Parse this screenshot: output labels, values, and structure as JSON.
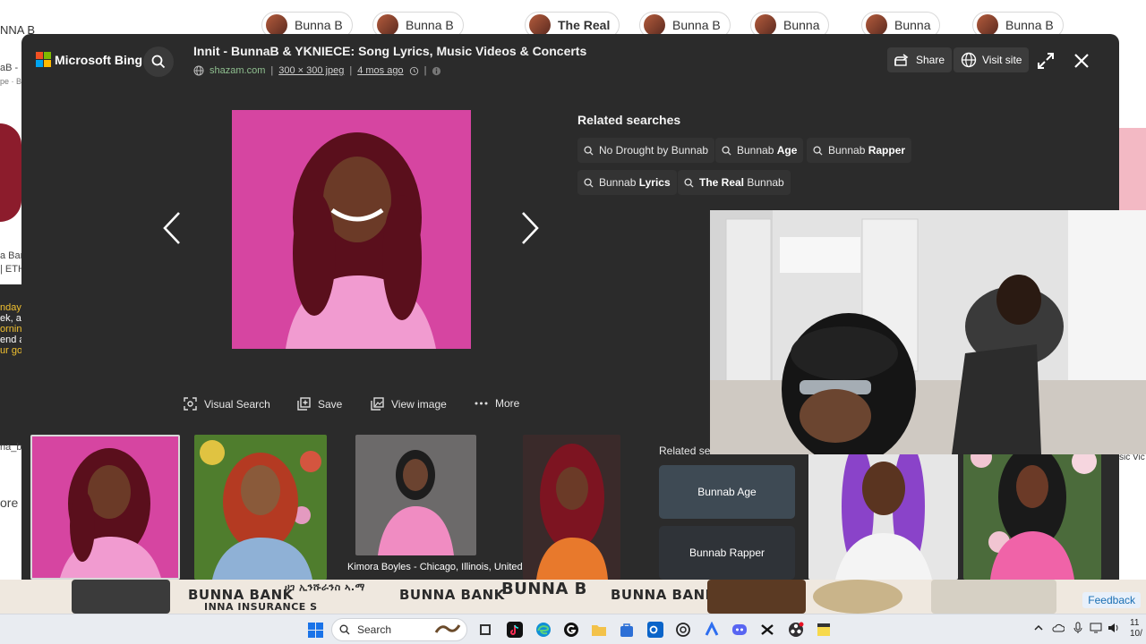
{
  "background": {
    "search_fragment": "NNA B",
    "pills": [
      {
        "label": "Bunna B",
        "bold": false
      },
      {
        "label": "Bunna B",
        "bold": false
      },
      {
        "label": "The Real",
        "bold": true
      },
      {
        "label": "Bunna B",
        "bold": false
      },
      {
        "label": "Bunna",
        "bold": false
      },
      {
        "label": "Bunna",
        "bold": false
      },
      {
        "label": "Bunna B",
        "bold": false
      }
    ],
    "left_texts": [
      "aB -",
      "pe · B",
      "a Bar",
      "| ETH",
      "nday",
      "ek, a",
      "orning",
      "end a",
      "ur go",
      "na_ba",
      "ore"
    ],
    "bottom_texts": [
      "BUNNA BANK",
      "BUNNA BANK",
      "BUNNA B",
      "BUNNA BANK",
      "INNA INSURANCE S",
      "ሀገ ኢንሹራንስ ኣ.ማ"
    ],
    "feedback": "Feedback",
    "right_text": "sic Vic"
  },
  "viewer": {
    "brand": "Microsoft Bing",
    "title": "Innit - BunnaB & YKNIECE: Song Lyrics, Music Videos & Concerts",
    "source_domain": "shazam.com",
    "image_size": "300 × 300 jpeg",
    "age": "4 mos ago",
    "share_label": "Share",
    "visit_label": "Visit site",
    "actions": {
      "visual_search": "Visual Search",
      "save": "Save",
      "view_image": "View image",
      "more": "More"
    },
    "related_title": "Related searches",
    "related_chips": [
      {
        "pre": "No Drought by Bunnab",
        "bold": ""
      },
      {
        "pre": "Bunnab ",
        "bold": "Age"
      },
      {
        "pre": "Bunnab ",
        "bold": "Rapper"
      },
      {
        "pre": "Bunnab ",
        "bold": "Lyrics"
      },
      {
        "pre": "",
        "bold": "The Real",
        "post": " Bunnab"
      }
    ],
    "strip_caption": "Kimora Boyles - Chicago, Illinois, United States |",
    "strip_related_label": "Related sea",
    "related_tiles": [
      "Bunnab Age",
      "Bunnab Rapper"
    ]
  },
  "taskbar": {
    "search_placeholder": "Search",
    "clock_time": "11",
    "clock_date": "10/"
  },
  "colors": {
    "overlay_bg": "#2b2b2b",
    "accent_pink": "#d83ea0",
    "chip_bg": "#333333"
  }
}
